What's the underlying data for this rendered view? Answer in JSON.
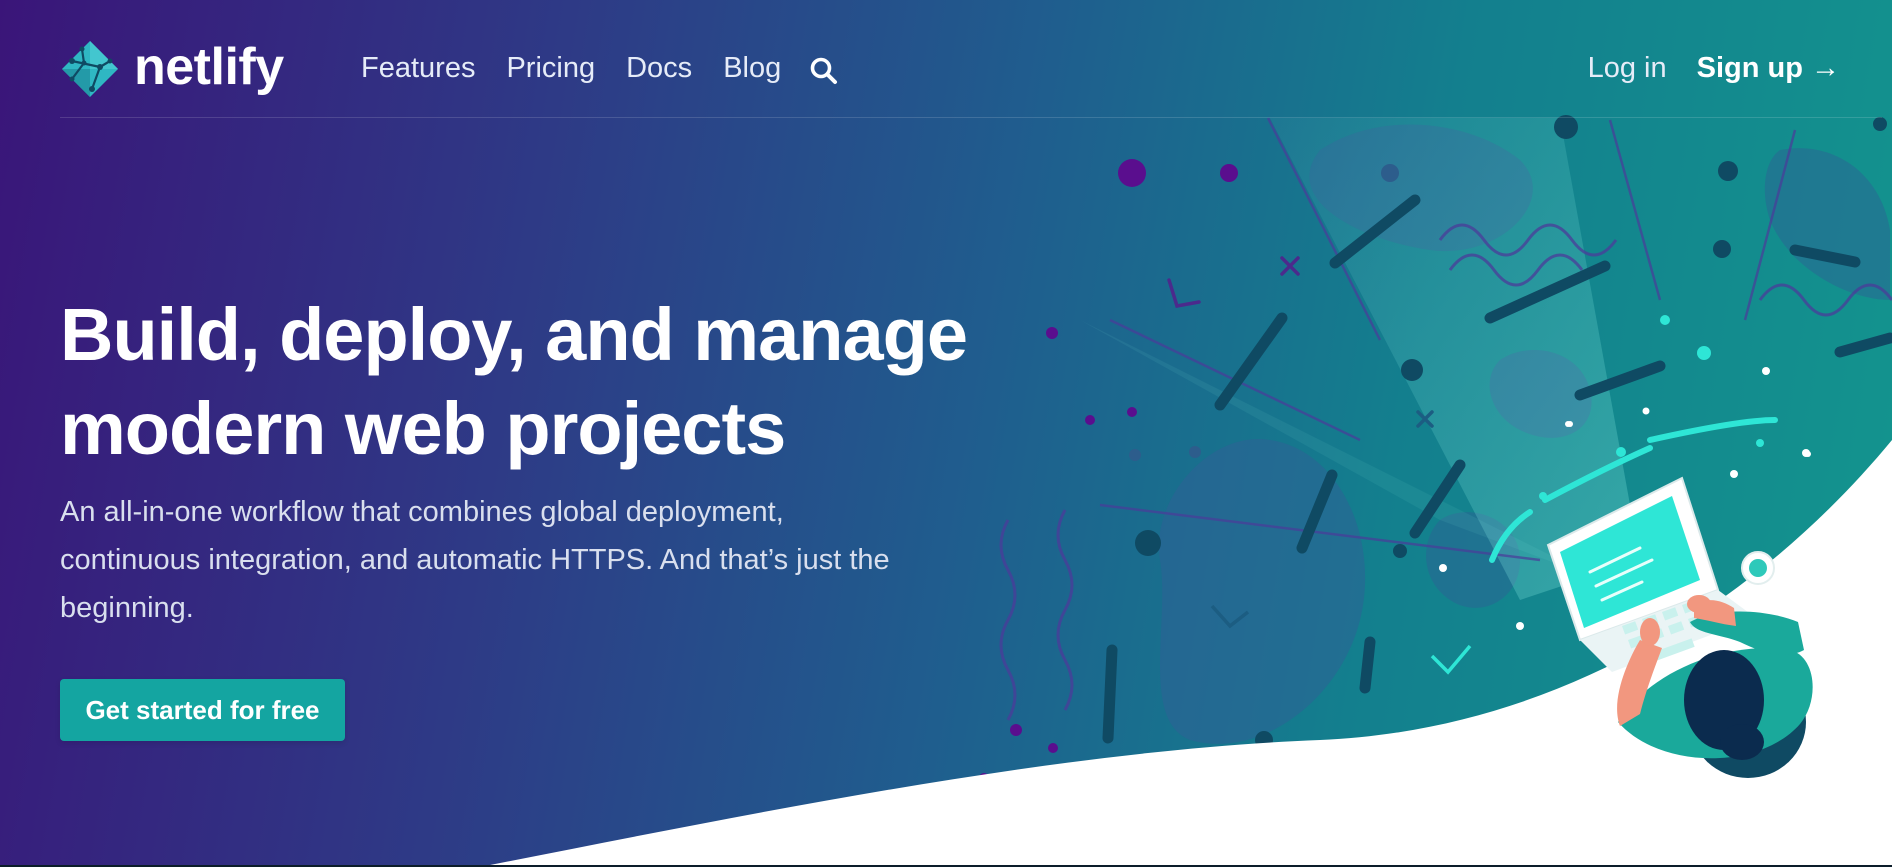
{
  "brand": {
    "name": "netlify",
    "logo_icon": "netlify-diamond-logo-icon"
  },
  "nav": {
    "links": [
      "Features",
      "Pricing",
      "Docs",
      "Blog"
    ],
    "search_icon": "search-icon",
    "login_label": "Log in",
    "signup_label": "Sign up →"
  },
  "hero": {
    "headline_line1": "Build, deploy, and manage",
    "headline_line2": "modern web projects",
    "lead_line1": "An all-in-one workflow that combines global deployment,",
    "lead_line2": "continuous integration, and automatic HTTPS. And that’s just the",
    "lead_line3": "beginning.",
    "cta_label": "Get started for free"
  },
  "colors": {
    "gradient_start": "#3a1579",
    "gradient_end": "#13968e",
    "accent_teal": "#14a5a1",
    "illustration_cyan": "#2ee6d6",
    "illustration_dark": "#0e4a5c"
  }
}
